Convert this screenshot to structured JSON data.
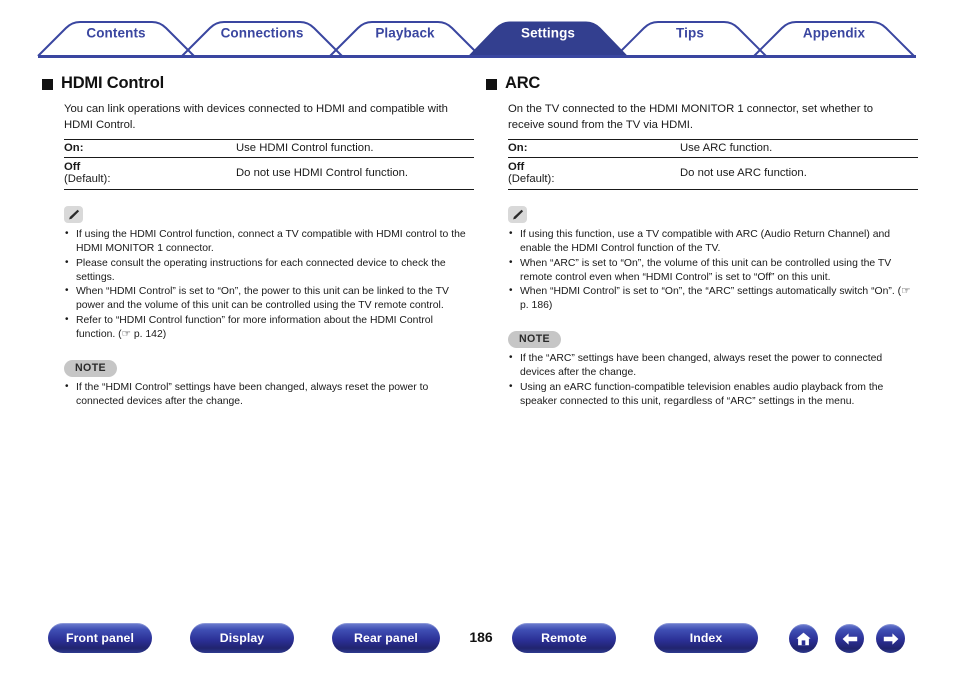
{
  "tabs": [
    {
      "label": "Contents",
      "active": false
    },
    {
      "label": "Connections",
      "active": false
    },
    {
      "label": "Playback",
      "active": false
    },
    {
      "label": "Settings",
      "active": true
    },
    {
      "label": "Tips",
      "active": false
    },
    {
      "label": "Appendix",
      "active": false
    }
  ],
  "colors": {
    "tab_outline": "#3a46a0",
    "tab_active_fill": "#333f8f",
    "tab_text": "#3a46a0",
    "tab_active_text": "#ffffff",
    "rule": "#3a46a0",
    "note_badge_bg": "#c6c6c6",
    "pill_blue": "#2b2f95"
  },
  "left": {
    "heading": "HDMI Control",
    "intro": "You can link operations with devices connected to HDMI and compatible with HDMI Control.",
    "table": [
      {
        "key": "On:",
        "key_sub": "",
        "value": "Use HDMI Control function."
      },
      {
        "key": "Off",
        "key_sub": "(Default):",
        "value": "Do not use HDMI Control function."
      }
    ],
    "tips": [
      "If using the HDMI Control function, connect a TV compatible with HDMI control to the HDMI MONITOR 1 connector.",
      "Please consult the operating instructions for each connected device to check the settings.",
      "When “HDMI Control” is set to “On”, the power to this unit can be linked to the TV power and the volume of this unit can be controlled using the TV remote control.",
      "Refer to “HDMI Control function” for more information about the HDMI Control function.  (☞ p. 142)"
    ],
    "note_label": "NOTE",
    "notes": [
      "If the “HDMI Control” settings have been changed, always reset the power to connected devices after the change."
    ]
  },
  "right": {
    "heading": "ARC",
    "intro": "On the TV connected to the HDMI MONITOR 1 connector, set whether to receive sound from the TV via HDMI.",
    "table": [
      {
        "key": "On:",
        "key_sub": "",
        "value": "Use ARC function."
      },
      {
        "key": "Off",
        "key_sub": "(Default):",
        "value": "Do not use ARC function."
      }
    ],
    "tips": [
      "If using this function, use a TV compatible with ARC (Audio Return Channel) and enable the HDMI Control function of the TV.",
      "When “ARC” is set to “On”, the volume of this unit can be controlled using the TV remote control even when “HDMI Control” is set to “Off” on this unit.",
      "When “HDMI Control” is set to “On”, the “ARC” settings automatically switch “On”.  (☞ p. 186)"
    ],
    "note_label": "NOTE",
    "notes": [
      "If the “ARC” settings have been changed, always reset the power to connected devices after the change.",
      "Using an eARC function-compatible television enables audio playback from the speaker connected to this unit, regardless of “ARC” settings in the menu."
    ]
  },
  "footer": {
    "buttons": [
      {
        "label": "Front panel"
      },
      {
        "label": "Display"
      },
      {
        "label": "Rear panel"
      },
      {
        "label": "Remote"
      },
      {
        "label": "Index"
      }
    ],
    "page_number": "186",
    "icons": [
      {
        "name": "home-icon"
      },
      {
        "name": "arrow-left-icon"
      },
      {
        "name": "arrow-right-icon"
      }
    ]
  }
}
